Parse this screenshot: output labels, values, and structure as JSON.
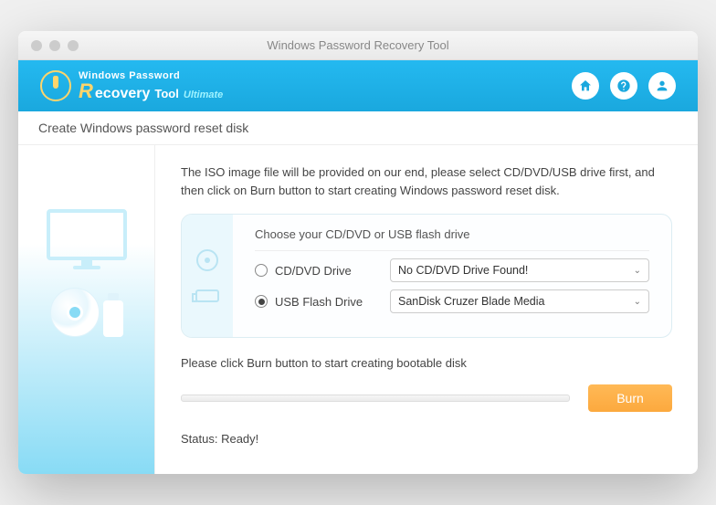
{
  "window": {
    "title": "Windows Password Recovery Tool"
  },
  "header": {
    "brand_line1": "Windows Password",
    "brand_r": "R",
    "brand_rest": "ecovery",
    "brand_tool": "Tool",
    "brand_edition": "Ultimate"
  },
  "subtitle": "Create Windows password reset disk",
  "instructions": "The ISO image file will be provided on our end, please select CD/DVD/USB drive first, and then click on Burn button to start creating Windows password reset disk.",
  "panel": {
    "choose_label": "Choose your CD/DVD or USB flash drive",
    "options": {
      "cd": {
        "label": "CD/DVD Drive",
        "selected": "No CD/DVD Drive Found!",
        "checked": false
      },
      "usb": {
        "label": "USB Flash Drive",
        "selected": "SanDisk Cruzer Blade Media",
        "checked": true
      }
    }
  },
  "burn_hint": "Please click Burn button to start creating bootable disk",
  "burn_label": "Burn",
  "status_label": "Status: Ready!"
}
